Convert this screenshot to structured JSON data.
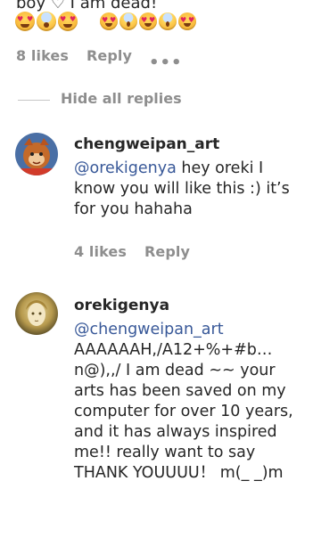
{
  "top": {
    "partial_text": "boy ♡ I am dead!",
    "emoji_row1": [
      "heart-eyes-emoji",
      "screaming-emoji",
      "heart-eyes-emoji",
      "screaming-emoji",
      "heart-eyes-emoji"
    ],
    "emoji_row2": [
      "heart-eyes-emoji",
      "screaming-emoji",
      "heart-eyes-emoji"
    ]
  },
  "parent_meta": {
    "likes": "8 likes",
    "reply": "Reply",
    "more": "•••"
  },
  "hide_replies": "Hide all replies",
  "replies": [
    {
      "username": "chengweipan_art",
      "mention": "@orekigenya",
      "text": " hey oreki I know you will like this :) it’s for you hahaha",
      "likes": "4 likes",
      "reply": "Reply"
    },
    {
      "username": "orekigenya",
      "mention": "@chengweipan_art",
      "text": "AAAAAAH,/A12+%+#b… n@),,/ I am dead ~~ your arts has been saved on my computer for over 10 years, and it has always inspired me!! really want to say THANK YOUUUU！ m(_ _)m"
    }
  ],
  "colors": {
    "text": "#262626",
    "secondary": "#8e8e8e",
    "mention": "#385898",
    "background": "#ffffff"
  }
}
